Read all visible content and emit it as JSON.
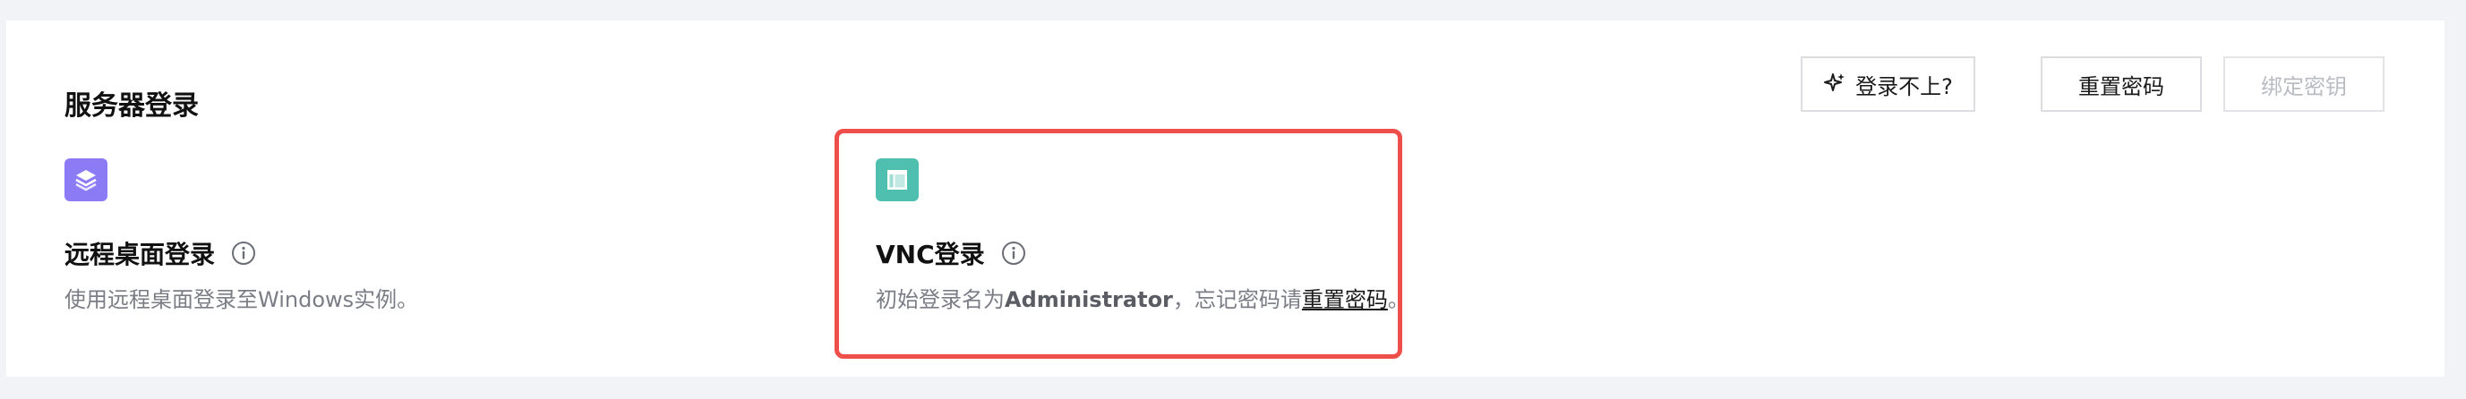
{
  "section": {
    "title": "服务器登录"
  },
  "buttons": {
    "cant_login": "登录不上?",
    "reset_password": "重置密码",
    "bind_key": "绑定密钥"
  },
  "methods": [
    {
      "title": "远程桌面登录",
      "description": "使用远程桌面登录至Windows实例。",
      "icon": "layers-icon",
      "icon_color": "#8b7cf6"
    },
    {
      "title": "VNC登录",
      "desc_prefix": "初始登录名为",
      "desc_username": "Administrator",
      "desc_middle": "，忘记密码请",
      "desc_link": "重置密码",
      "desc_suffix": "。",
      "icon": "window-layout-icon",
      "icon_color": "#4fc0b0"
    }
  ],
  "colors": {
    "highlight_border": "#ee4f4a",
    "page_background": "#f2f3f6"
  }
}
